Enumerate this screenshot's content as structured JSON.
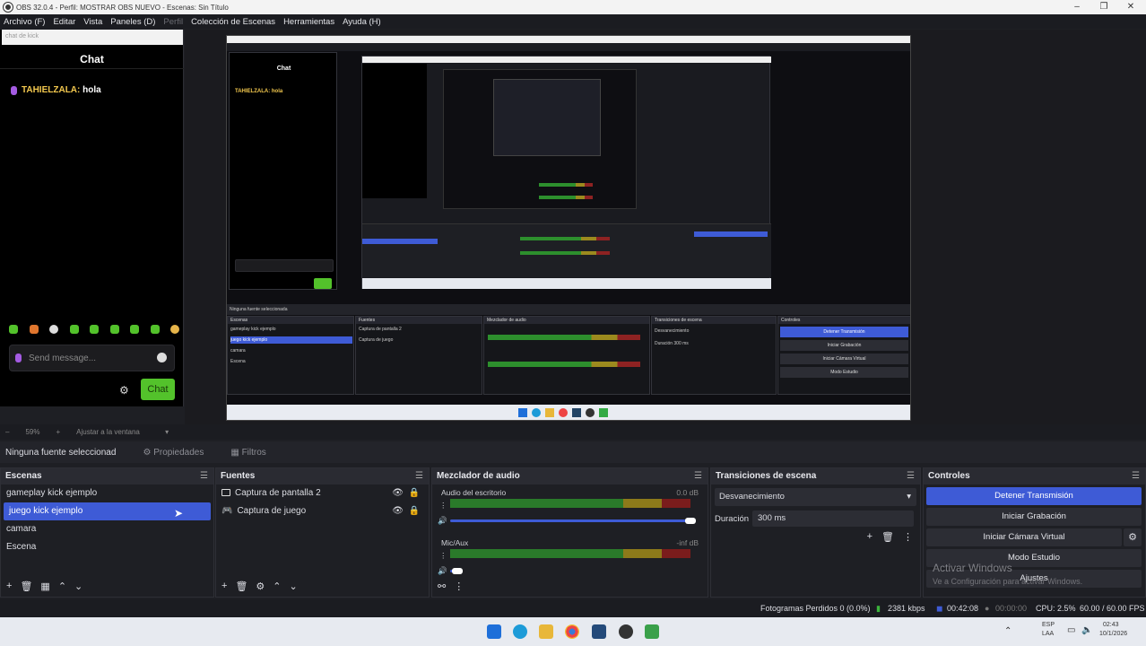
{
  "window": {
    "title": "OBS 32.0.4 - Perfil: MOSTRAR OBS NUEVO - Escenas: Sin Título"
  },
  "menu": {
    "items": [
      "Archivo (F)",
      "Editar",
      "Vista",
      "Paneles (D)",
      "Perfil",
      "Colección de Escenas",
      "Herramientas",
      "Ayuda (H)"
    ]
  },
  "chat": {
    "url": "chat de kick",
    "title": "Chat",
    "message_user": "TAHIELZALA:",
    "message_text": "hola",
    "input_placeholder": "Send message...",
    "send_label": "Chat"
  },
  "preview": {
    "zoom": "59%",
    "fit_label": "Ajustar a la ventana"
  },
  "source_bar": {
    "none_selected": "Ninguna fuente seleccionad",
    "properties": "Propiedades",
    "filters": "Filtros"
  },
  "scenes": {
    "title": "Escenas",
    "items": [
      "gameplay kick ejemplo",
      "juego kick ejemplo",
      "camara",
      "Escena"
    ],
    "selected_index": 1
  },
  "sources": {
    "title": "Fuentes",
    "items": [
      "Captura de pantalla 2",
      "Captura de juego"
    ]
  },
  "mixer": {
    "title": "Mezclador de audio",
    "channels": [
      {
        "name": "Audio del escritorio",
        "db": "0.0 dB"
      },
      {
        "name": "Mic/Aux",
        "db": "-inf dB"
      }
    ]
  },
  "transitions": {
    "title": "Transiciones de escena",
    "selected": "Desvanecimiento",
    "duration_label": "Duración",
    "duration_value": "300 ms"
  },
  "controls": {
    "title": "Controles",
    "stop_stream": "Detener Transmisión",
    "start_recording": "Iniciar Grabación",
    "virtual_camera": "Iniciar Cámara Virtual",
    "studio_mode": "Modo Estudio",
    "settings": "Ajustes"
  },
  "watermark": {
    "line1": "Activar Windows",
    "line2": "Ve a Configuración para activar Windows."
  },
  "status": {
    "dropped_frames": "Fotogramas Perdidos 0 (0.0%)",
    "bitrate": "2381 kbps",
    "live_time": "00:42:08",
    "rec_time": "00:00:00",
    "cpu": "CPU: 2.5%",
    "fps": "60.00 / 60.00 FPS"
  },
  "taskbar": {
    "lang": "ESP",
    "lang2": "LAA",
    "time": "02:43",
    "date": "10/1/2026"
  },
  "colors": {
    "accent": "#3e5bd6",
    "kick_green": "#53c22b",
    "dock_bg": "#1e1f24"
  }
}
